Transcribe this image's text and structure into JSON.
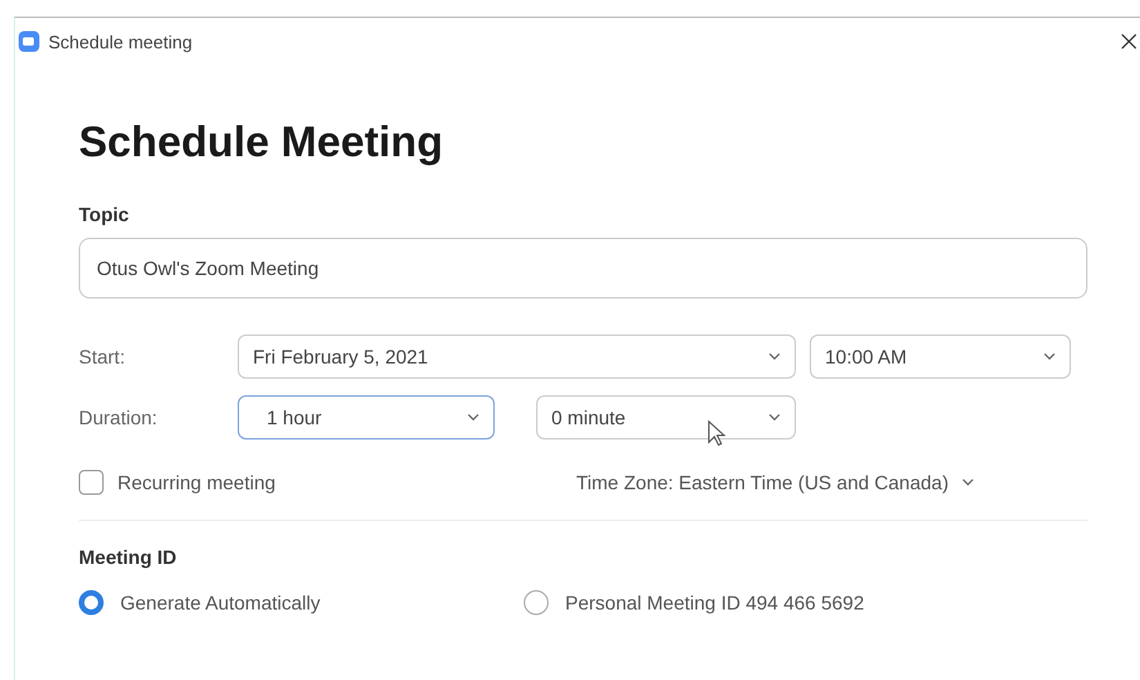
{
  "window": {
    "title": "Schedule meeting"
  },
  "heading": "Schedule Meeting",
  "topic": {
    "label": "Topic",
    "value": "Otus Owl's Zoom Meeting"
  },
  "start": {
    "label": "Start:",
    "date": {
      "value": "Fri February 5, 2021",
      "focused": false
    },
    "time": {
      "value": "10:00 AM",
      "focused": false
    }
  },
  "duration": {
    "label": "Duration:",
    "hours": {
      "value": "1 hour",
      "focused": true
    },
    "minutes": {
      "value": "0 minute",
      "focused": false
    }
  },
  "recurring": {
    "label": "Recurring meeting",
    "checked": false
  },
  "time_zone": "Time Zone: Eastern Time (US and Canada)",
  "meeting_id": {
    "label": "Meeting ID",
    "options": [
      {
        "label": "Generate Automatically",
        "selected": true
      },
      {
        "label": "Personal Meeting ID 494 466 5692",
        "selected": false
      }
    ]
  }
}
